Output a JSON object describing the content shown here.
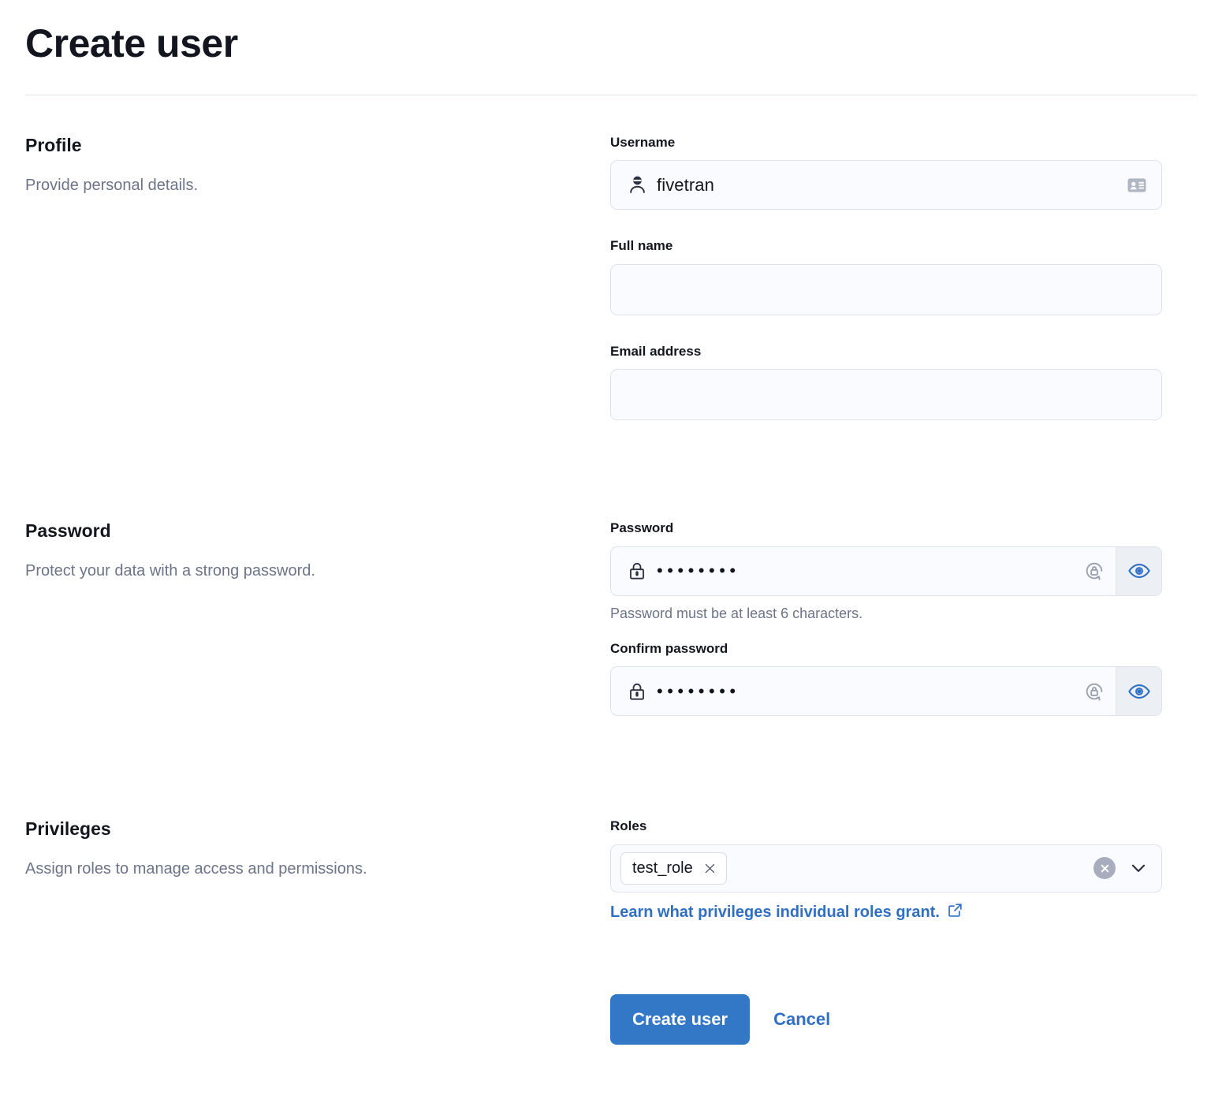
{
  "header": {
    "title": "Create user"
  },
  "sections": {
    "profile": {
      "heading": "Profile",
      "description": "Provide personal details."
    },
    "password": {
      "heading": "Password",
      "description": "Protect your data with a strong password."
    },
    "privileges": {
      "heading": "Privileges",
      "description": "Assign roles to manage access and permissions."
    }
  },
  "fields": {
    "username": {
      "label": "Username",
      "value": "fivetran",
      "placeholder": "",
      "left_icon": "user-icon",
      "right_icon": "id-card-icon"
    },
    "full_name": {
      "label": "Full name",
      "value": "",
      "placeholder": ""
    },
    "email_address": {
      "label": "Email address",
      "value": "",
      "placeholder": ""
    },
    "password": {
      "label": "Password",
      "value": "••••••••",
      "help": "Password must be at least 6 characters.",
      "left_icon": "lock-icon",
      "generate_icon": "generate-password-icon",
      "toggle_icon": "eye-icon"
    },
    "confirm_password": {
      "label": "Confirm password",
      "value": "••••••••",
      "left_icon": "lock-icon",
      "generate_icon": "generate-password-icon",
      "toggle_icon": "eye-icon"
    },
    "roles": {
      "label": "Roles",
      "tags": [
        "test_role"
      ],
      "clear_icon": "clear-circle-icon",
      "chevron_icon": "chevron-down-icon",
      "link_text": "Learn what privileges individual roles grant.",
      "link_icon": "external-link-icon"
    }
  },
  "actions": {
    "submit_label": "Create user",
    "cancel_label": "Cancel"
  },
  "colors": {
    "accent": "#3278c6",
    "link": "#2f6fc4",
    "text": "#14161f",
    "muted": "#6b7488",
    "field_bg": "#fafbfe",
    "field_border": "#dde2ed",
    "divider": "#dbe0ec",
    "clear_circle": "#a7adbd",
    "addon_bg": "#ecf0f5"
  }
}
